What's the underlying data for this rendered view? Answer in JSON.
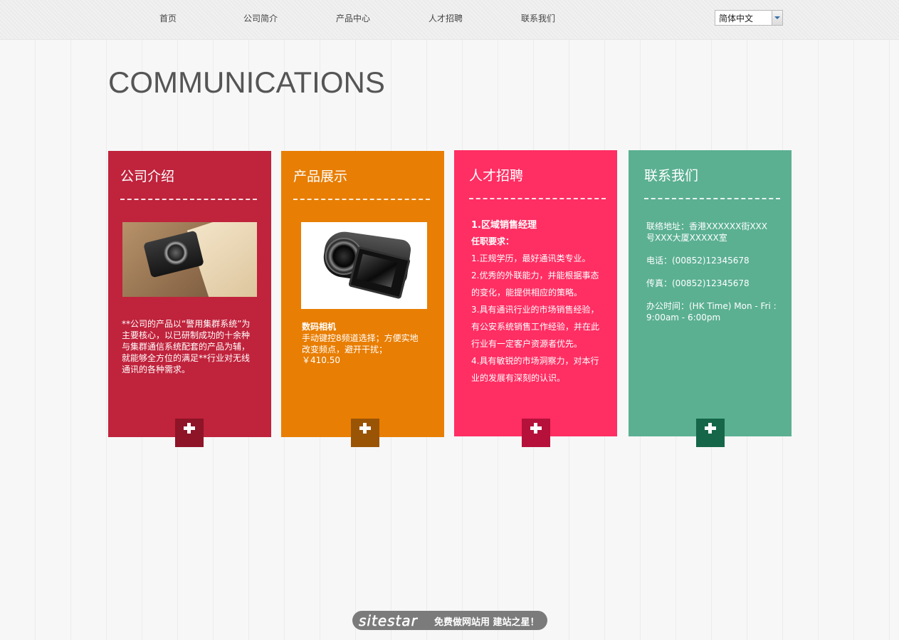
{
  "nav": {
    "items": [
      {
        "label": "首页"
      },
      {
        "label": "公司简介"
      },
      {
        "label": "产品中心"
      },
      {
        "label": "人才招聘"
      },
      {
        "label": "联系我们"
      }
    ],
    "language": "简体中文"
  },
  "page": {
    "title": "COMMUNICATIONS"
  },
  "cards": [
    {
      "title": "公司介绍",
      "color": "#c0233c",
      "button_color": "#8e1427",
      "text": "**公司的产品以“警用集群系统”为主要核心，以已研制成功的十余种与集群通信系统配套的产品为辅，就能够全方位的满足**行业对无线通讯的各种需求。"
    },
    {
      "title": "产品展示",
      "color": "#e87e03",
      "button_color": "#9a5405",
      "product_name": "数码相机",
      "product_desc": "手动键控8频道选择；方便实地改变频点，避开干扰；",
      "product_price": "￥410.50"
    },
    {
      "title": "人才招聘",
      "color": "#ff2e63",
      "button_color": "#b5113a",
      "job_title": "1.区域销售经理",
      "req_heading": "任职要求：",
      "requirements": [
        "1.正规学历，最好通讯类专业。",
        "2.优秀的外联能力，并能根据事态的变化，能提供相应的策略。",
        "3.具有通讯行业的市场销售经验，有公安系统销售工作经验，并在此行业有一定客户资源者优先。",
        "4.具有敏锐的市场洞察力，对本行业的发展有深刻的认识。"
      ]
    },
    {
      "title": "联系我们",
      "color": "#5bb092",
      "button_color": "#16674a",
      "address": "联络地址：香港XXXXXX街XXX号XXX大厦XXXXX室",
      "phone": "电话：(00852)12345678",
      "fax": "传真：(00852)12345678",
      "hours": "办公时间：(HK Time) Mon - Fri : 9:00am - 6:00pm"
    }
  ],
  "footer": {
    "brand": "sitestar",
    "slogan": "免费做网站用 建站之星！"
  }
}
